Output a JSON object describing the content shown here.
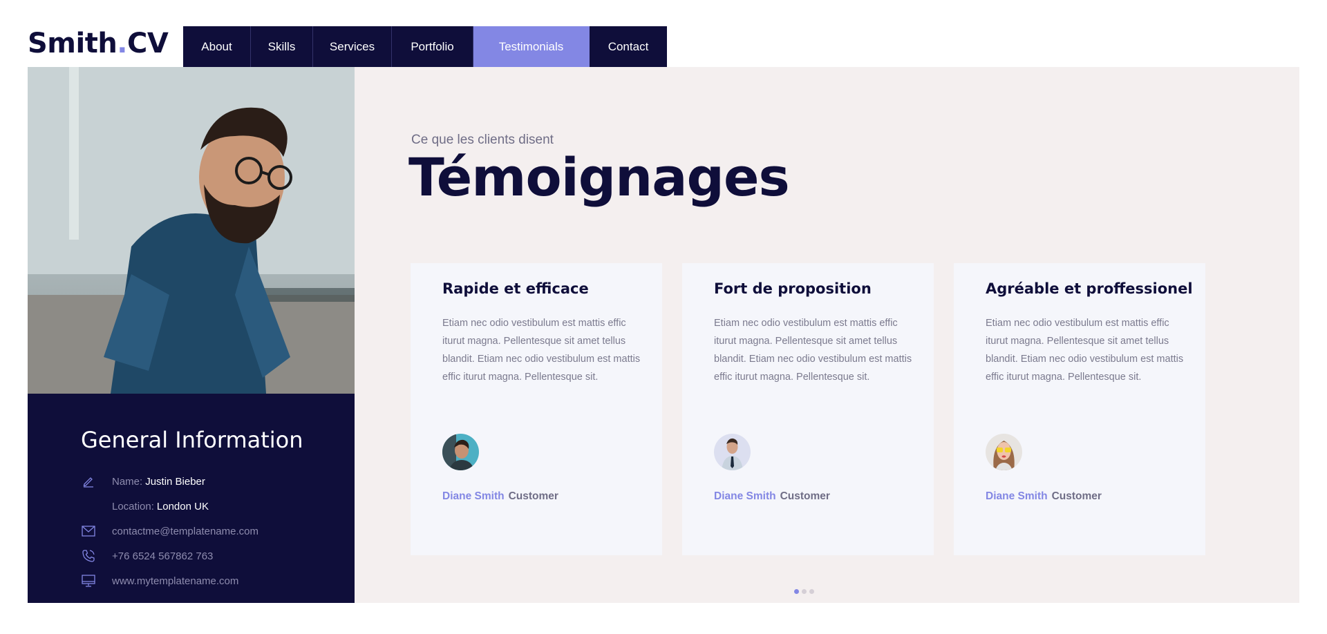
{
  "brand": {
    "name": "Smith",
    "dot": ".",
    "suffix": "CV"
  },
  "nav": {
    "items": [
      {
        "label": "About"
      },
      {
        "label": "Skills"
      },
      {
        "label": "Services"
      },
      {
        "label": "Portfolio"
      },
      {
        "label": "Testimonials",
        "active": true
      },
      {
        "label": "Contact"
      }
    ]
  },
  "profile": {
    "photo": "man-in-denim-shirt-with-glasses",
    "heading": "General Information",
    "name_label": "Name:",
    "name_value": "Justin Bieber",
    "location_label": "Location:",
    "location_value": "London UK",
    "email": "contactme@templatename.com",
    "phone": "+76 6524 567862 763",
    "website": "www.mytemplatename.com"
  },
  "section": {
    "eyebrow": "Ce que les clients disent",
    "title": "Témoignages"
  },
  "testimonials": [
    {
      "title": "Rapide et efficace",
      "text": "Etiam nec odio vestibulum est mattis effic iturut magna. Pellentesque sit amet tellus blandit. Etiam nec odio vestibulum est mattis effic iturut magna. Pellentesque sit.",
      "name": "Diane Smith",
      "role": "Customer",
      "avatar": "young-man-avatar"
    },
    {
      "title": "Fort de proposition",
      "text": "Etiam nec odio vestibulum est mattis effic iturut magna. Pellentesque sit amet tellus blandit. Etiam nec odio vestibulum est mattis effic iturut magna. Pellentesque sit.",
      "name": "Diane Smith",
      "role": "Customer",
      "avatar": "businessman-avatar"
    },
    {
      "title": "Agréable et proffessionel",
      "text": "Etiam nec odio vestibulum est mattis effic iturut magna. Pellentesque sit amet tellus blandit. Etiam nec odio vestibulum est mattis effic iturut magna. Pellentesque sit.",
      "name": "Diane Smith",
      "role": "Customer",
      "avatar": "woman-with-sunglasses-avatar"
    }
  ],
  "carousel": {
    "pages": 3,
    "active_index": 0
  },
  "colors": {
    "navy": "#0f0e3a",
    "accent": "#8387e4",
    "panel": "#f4efef",
    "card": "#f5f6fb"
  }
}
